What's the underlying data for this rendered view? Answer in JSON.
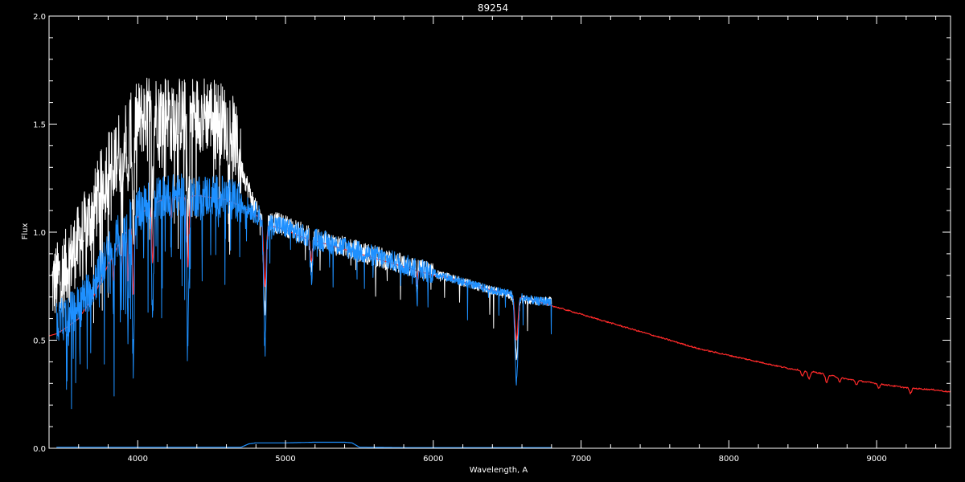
{
  "chart_data": {
    "type": "line",
    "title": "89254",
    "xlabel": "Wavelength, A",
    "ylabel": "Flux",
    "xlim": [
      3400,
      9500
    ],
    "ylim": [
      0.0,
      2.0
    ],
    "x_ticks": [
      4000,
      5000,
      6000,
      7000,
      8000,
      9000
    ],
    "x_tick_labels": [
      "4000",
      "5000",
      "6000",
      "7000",
      "8000",
      "9000"
    ],
    "x_minor_step": 200,
    "y_ticks": [
      0.0,
      0.5,
      1.0,
      1.5,
      2.0
    ],
    "y_tick_labels": [
      "0.0",
      "0.5",
      "1.0",
      "1.5",
      "2.0"
    ],
    "y_minor_step": 0.1,
    "grid": false,
    "background": "#000000",
    "axis_color": "#ffffff",
    "series": [
      {
        "color": "#ffffff",
        "style": "noisy",
        "x": [
          3420,
          3500,
          3600,
          3700,
          3800,
          3900,
          4000,
          4100,
          4200,
          4300,
          4400,
          4500,
          4600,
          4650,
          4700,
          4750,
          4800,
          4850,
          4900,
          5000,
          5100,
          5200,
          5300,
          5400,
          5500,
          5600,
          5700,
          5800,
          5900,
          6000,
          6100,
          6200,
          6300,
          6400,
          6500,
          6600,
          6700,
          6800
        ],
        "y": [
          0.75,
          0.82,
          0.95,
          1.1,
          1.3,
          1.42,
          1.52,
          1.56,
          1.56,
          1.54,
          1.55,
          1.55,
          1.5,
          1.45,
          1.3,
          1.2,
          1.1,
          1.05,
          1.05,
          1.03,
          1.0,
          0.97,
          0.95,
          0.93,
          0.91,
          0.89,
          0.87,
          0.85,
          0.83,
          0.81,
          0.79,
          0.77,
          0.75,
          0.73,
          0.71,
          0.69,
          0.68,
          0.68
        ]
      },
      {
        "color": "#ff2a2a",
        "style": "smooth",
        "x": [
          3400,
          3450,
          3500,
          3600,
          3700,
          3800,
          3900,
          4000,
          4100,
          4200,
          4300,
          4400,
          4500,
          4600,
          4700,
          4800,
          4850,
          4900,
          5000,
          5100,
          5200,
          5300,
          5400,
          5500,
          5600,
          5700,
          5800,
          5900,
          6000,
          6100,
          6200,
          6300,
          6400,
          6500,
          6560,
          6600,
          6700,
          6800,
          7000,
          7200,
          7400,
          7600,
          7800,
          8000,
          8200,
          8400,
          8600,
          8800,
          9000,
          9200,
          9400,
          9500
        ],
        "y": [
          0.52,
          0.53,
          0.55,
          0.6,
          0.7,
          0.85,
          0.98,
          1.07,
          1.13,
          1.16,
          1.16,
          1.17,
          1.16,
          1.15,
          1.12,
          1.08,
          1.05,
          1.03,
          1.01,
          0.98,
          0.96,
          0.94,
          0.92,
          0.9,
          0.88,
          0.86,
          0.84,
          0.82,
          0.8,
          0.79,
          0.77,
          0.75,
          0.73,
          0.72,
          0.7,
          0.7,
          0.68,
          0.66,
          0.62,
          0.58,
          0.54,
          0.5,
          0.46,
          0.43,
          0.4,
          0.37,
          0.35,
          0.32,
          0.3,
          0.28,
          0.27,
          0.26
        ]
      },
      {
        "color": "#1e90ff",
        "style": "noisy",
        "x": [
          3450,
          3500,
          3600,
          3700,
          3800,
          3900,
          4000,
          4100,
          4200,
          4300,
          4400,
          4500,
          4600,
          4700,
          4800,
          4850,
          4900,
          5000,
          5100,
          5200,
          5300,
          5400,
          5500,
          5600,
          5700,
          5800,
          5900,
          6000,
          6100,
          6200,
          6300,
          6400,
          6500,
          6600,
          6700,
          6800
        ],
        "y": [
          0.58,
          0.6,
          0.66,
          0.76,
          0.9,
          1.02,
          1.1,
          1.15,
          1.17,
          1.17,
          1.17,
          1.17,
          1.16,
          1.13,
          1.09,
          1.06,
          1.04,
          1.02,
          0.99,
          0.97,
          0.95,
          0.93,
          0.91,
          0.89,
          0.87,
          0.85,
          0.83,
          0.81,
          0.79,
          0.77,
          0.75,
          0.73,
          0.72,
          0.7,
          0.68,
          0.68
        ]
      },
      {
        "color": "#1e90ff",
        "style": "smooth",
        "x": [
          3450,
          4000,
          4700,
          4750,
          4800,
          5000,
          5200,
          5400,
          5450,
          5500,
          5800,
          6800
        ],
        "y": [
          0.005,
          0.005,
          0.005,
          0.02,
          0.025,
          0.025,
          0.028,
          0.028,
          0.025,
          0.005,
          0.003,
          0.003
        ]
      }
    ],
    "absorption_lines": [
      {
        "x": 3835,
        "depth": 0.25,
        "width": 6
      },
      {
        "x": 3889,
        "depth": 0.3,
        "width": 7
      },
      {
        "x": 3934,
        "depth": 0.55,
        "width": 5
      },
      {
        "x": 3970,
        "depth": 0.7,
        "width": 8
      },
      {
        "x": 4101,
        "depth": 0.55,
        "width": 9
      },
      {
        "x": 4227,
        "depth": 0.2,
        "width": 5
      },
      {
        "x": 4340,
        "depth": 0.65,
        "width": 10
      },
      {
        "x": 4861,
        "depth": 0.6,
        "width": 12
      },
      {
        "x": 5175,
        "depth": 0.2,
        "width": 10
      },
      {
        "x": 5890,
        "depth": 0.15,
        "width": 5
      },
      {
        "x": 6563,
        "depth": 0.4,
        "width": 14
      },
      {
        "x": 8498,
        "depth": 0.05,
        "width": 12
      },
      {
        "x": 8542,
        "depth": 0.07,
        "width": 12
      },
      {
        "x": 8662,
        "depth": 0.07,
        "width": 12
      },
      {
        "x": 8750,
        "depth": 0.04,
        "width": 10
      },
      {
        "x": 8863,
        "depth": 0.04,
        "width": 10
      },
      {
        "x": 9015,
        "depth": 0.04,
        "width": 10
      },
      {
        "x": 9229,
        "depth": 0.05,
        "width": 10
      }
    ]
  }
}
